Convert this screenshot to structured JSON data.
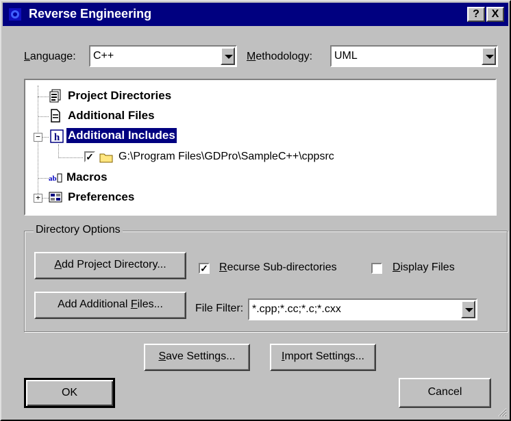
{
  "window": {
    "title": "Reverse Engineering",
    "help_label": "?",
    "close_label": "X"
  },
  "language": {
    "label_mnemonic": "L",
    "label_rest": "anguage:",
    "value": "C++"
  },
  "methodology": {
    "label_mnemonic": "M",
    "label_rest": "ethodology:",
    "value": "UML"
  },
  "tree": {
    "items": [
      {
        "label": "Project Directories",
        "icon": "project-directories-icon",
        "selected": false
      },
      {
        "label": "Additional Files",
        "icon": "document-icon",
        "selected": false
      },
      {
        "label": "Additional Includes",
        "icon": "header-h-icon",
        "selected": true,
        "expanded": true
      },
      {
        "label": "G:\\Program Files\\GDPro\\SampleC++\\cppsrc",
        "icon": "folder-icon",
        "checked": true
      },
      {
        "label": "Macros",
        "icon": "abc-icon",
        "selected": false
      },
      {
        "label": "Preferences",
        "icon": "preferences-icon",
        "selected": false,
        "expanded": false
      }
    ],
    "expand_minus": "−",
    "expand_plus": "+"
  },
  "directory_options": {
    "title": "Directory Options",
    "add_project_dir_mnemonic": "A",
    "add_project_dir_rest": "dd Project Directory...",
    "recurse_mnemonic": "R",
    "recurse_rest": "ecurse Sub-directories",
    "recurse_checked": true,
    "display_files_mnemonic": "D",
    "display_files_rest": "isplay Files",
    "display_files_checked": false,
    "add_files_pre": "Add Additional ",
    "add_files_mnemonic": "F",
    "add_files_rest": "iles...",
    "file_filter_label": "File Filter:",
    "file_filter_value": "*.cpp;*.cc;*.c;*.cxx"
  },
  "buttons": {
    "save_mnemonic": "S",
    "save_rest": "ave Settings...",
    "import_mnemonic": "I",
    "import_rest": "mport Settings...",
    "ok": "OK",
    "cancel": "Cancel"
  },
  "colors": {
    "titlebar": "#000080",
    "face": "#c0c0c0",
    "selection": "#000080"
  }
}
